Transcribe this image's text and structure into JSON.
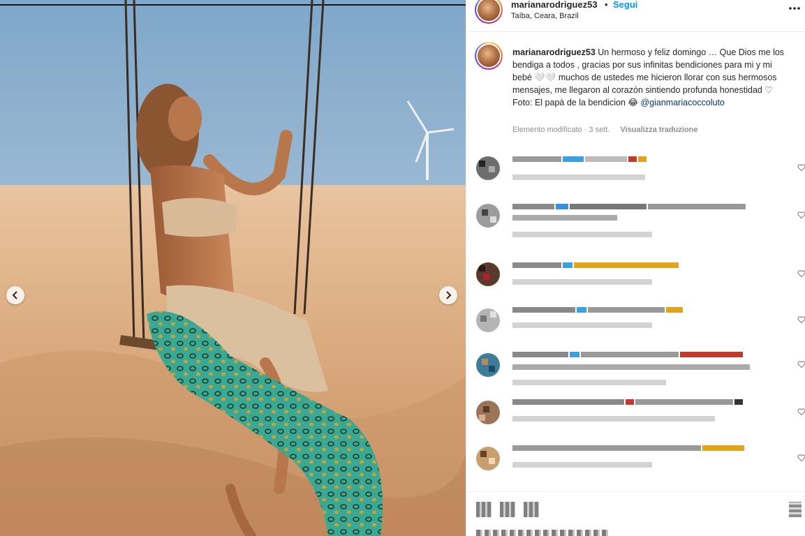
{
  "post": {
    "username": "marianarodriguez53",
    "separator": "•",
    "follow_label": "Segui",
    "location": "Taíba, Ceara, Brazil"
  },
  "caption": {
    "username": "marianarodriguez53",
    "text": "Un hermoso y feliz domingo … Que Dios me los bendiga a todos , gracias por sus infinitas bendiciones para mi y mi bebé 🤍🤍 muchos de ustedes me hicieron llorar con sus hermosos mensajes, me llegaron al corazón sintiendo profunda honestidad ♡",
    "photo_credit_prefix": "Foto: El papà de la bendicion 😂",
    "mention": "@gianmariacoccoluto",
    "meta": "Elemento modificato · 3 sett.",
    "translate_label": "Visualizza traduzione"
  },
  "comments_count_visible": 7,
  "colors": {
    "accent": "#0095f6",
    "mention": "#00376b",
    "meta": "#8e8e8e",
    "sand": "#e0b48a",
    "sky": "#8fb3d0",
    "scarf": "#2e9e8a"
  },
  "icons": {
    "more": "more-dots-icon",
    "prev": "chevron-left-icon",
    "next": "chevron-right-icon",
    "like": "heart-icon"
  }
}
